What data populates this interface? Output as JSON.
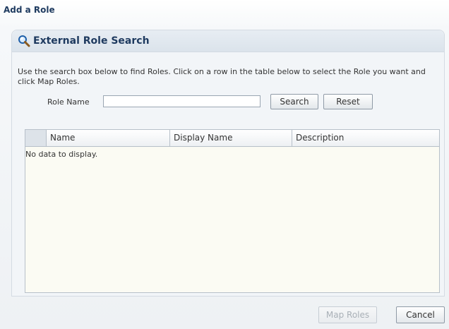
{
  "dialog": {
    "title": "Add a Role"
  },
  "panel": {
    "title": "External Role Search",
    "icon": "magnifier-icon",
    "instructions": "Use the search box below to find Roles. Click on a row in the table below to select the Role you want and click Map Roles."
  },
  "search": {
    "label": "Role Name",
    "value": "",
    "search_button": "Search",
    "reset_button": "Reset"
  },
  "table": {
    "columns": [
      "Name",
      "Display Name",
      "Description"
    ],
    "rows": [],
    "empty_message": "No data to display."
  },
  "footer": {
    "map_roles_button": "Map Roles",
    "map_roles_enabled": false,
    "cancel_button": "Cancel"
  }
}
